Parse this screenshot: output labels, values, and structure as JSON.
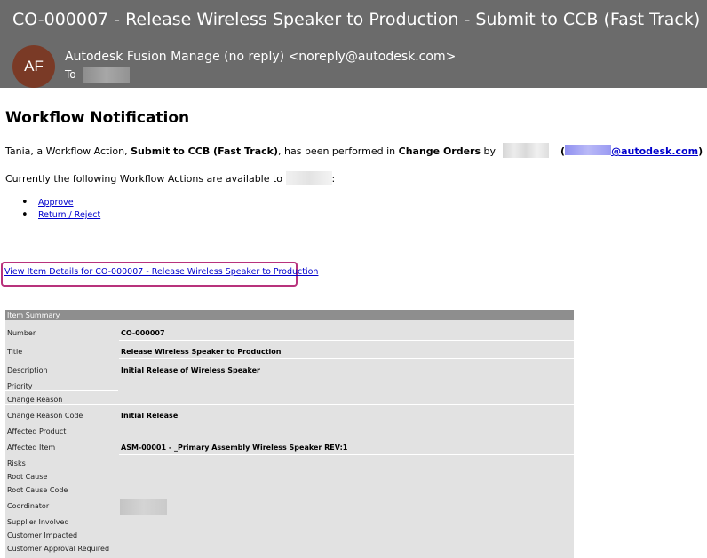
{
  "email": {
    "subject": "CO-000007 - Release Wireless Speaker to Production - Submit to CCB (Fast Track)",
    "avatar_initials": "AF",
    "sender": "Autodesk Fusion Manage (no reply) <noreply@autodesk.com>",
    "to_label": "To"
  },
  "body": {
    "title": "Workflow Notification",
    "line1_prefix": "Tania, a Workflow Action, ",
    "line1_action": "Submit to CCB (Fast Track)",
    "line1_mid": ", has been performed in ",
    "line1_workspace": "Change Orders",
    "line1_by": " by",
    "email_domain": "@autodesk.com",
    "line2_prefix": "Currently the following Workflow Actions are available to",
    "line2_suffix": ":",
    "actions": [
      "Approve",
      "Return / Reject"
    ],
    "view_link": "View Item Details for CO-000007 - Release Wireless Speaker to Production"
  },
  "summary": {
    "header": "Item Summary",
    "rows": [
      {
        "label": "Number",
        "value": "CO-000007"
      },
      {
        "label": "Title",
        "value": "Release Wireless Speaker to Production"
      },
      {
        "label": "Description",
        "value": "Initial Release of Wireless Speaker"
      },
      {
        "label": "Priority",
        "value": ""
      },
      {
        "label": "Change Reason",
        "value": ""
      },
      {
        "label": "Change Reason Code",
        "value": "Initial Release"
      },
      {
        "label": "Affected Product",
        "value": ""
      },
      {
        "label": "Affected Item",
        "value": "ASM-00001 - _Primary Assembly Wireless Speaker REV:1"
      },
      {
        "label": "Risks",
        "value": ""
      },
      {
        "label": "Root Cause",
        "value": ""
      },
      {
        "label": "Root Cause Code",
        "value": ""
      },
      {
        "label": "Coordinator",
        "value": ""
      },
      {
        "label": "Supplier Involved",
        "value": ""
      },
      {
        "label": "Customer Impacted",
        "value": ""
      },
      {
        "label": "Customer Approval Required",
        "value": ""
      }
    ]
  },
  "colors": {
    "header_bg": "#6b6b6b",
    "avatar_bg": "#7a3a26",
    "link": "#0000cc",
    "highlight_border": "#b8327c",
    "summary_bg": "#e2e2e2",
    "summary_header_bg": "#8e8e8e"
  }
}
